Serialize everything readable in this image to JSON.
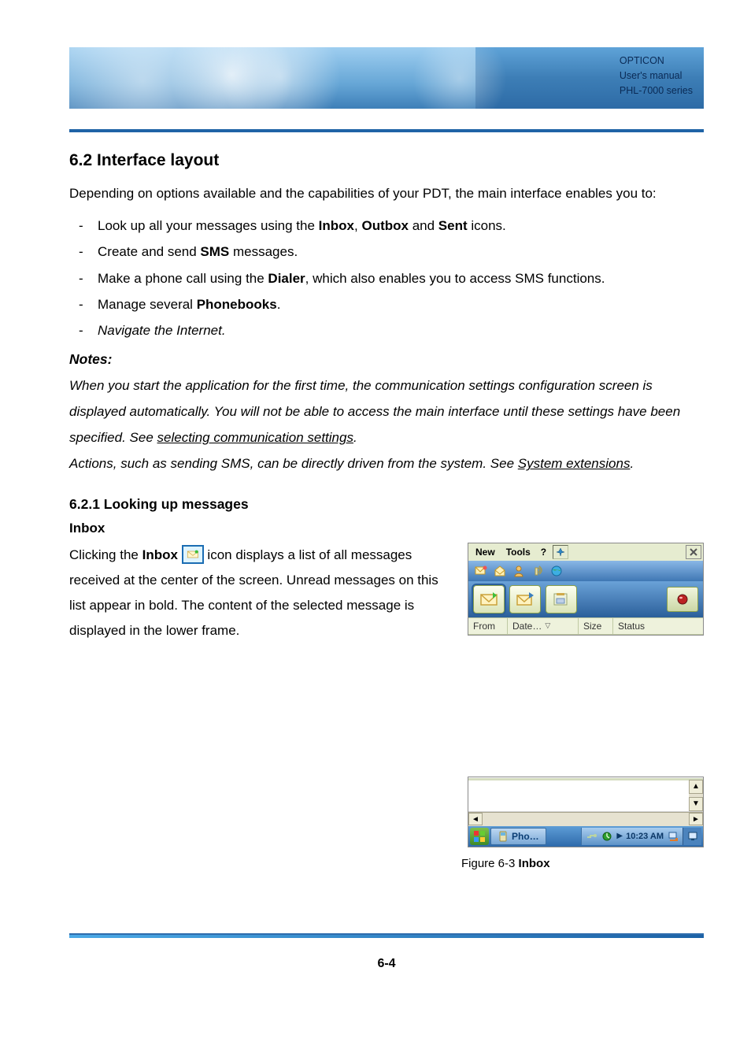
{
  "banner": {
    "line1": "OPTICON",
    "line2": "User's manual",
    "line3": "PHL-7000 series"
  },
  "section_title": "6.2 Interface layout",
  "intro": "Depending on options available and the capabilities of your PDT, the main interface enables you to:",
  "bullets": {
    "b1_pre": "Look up all your messages using the ",
    "b1_inbox": "Inbox",
    "b1_mid1": ", ",
    "b1_outbox": "Outbox",
    "b1_mid2": " and ",
    "b1_sent": "Sent",
    "b1_post": " icons.",
    "b2_pre": "Create and send ",
    "b2_sms": "SMS",
    "b2_post": " messages.",
    "b3_pre": "Make a phone call using the ",
    "b3_dialer": "Dialer",
    "b3_post": ", which also enables you to access SMS functions.",
    "b4_pre": "Manage several ",
    "b4_phone": "Phonebooks",
    "b4_post": ".",
    "b5": "Navigate the Internet."
  },
  "notes_heading": "Notes:",
  "notes": {
    "p1a": "When you start the application for the first time, the communication settings configuration screen is displayed automatically. You will not be able to access the main interface until these settings have been specified. See ",
    "p1link": "selecting communication settings",
    "p1b": ".",
    "p2a": "Actions, such as sending SMS, can be directly driven from the system. See ",
    "p2link": "System extensions",
    "p2b": "."
  },
  "sub_heading": "6.2.1 Looking up messages",
  "inbox_heading": "Inbox",
  "inbox_para": {
    "a": "Clicking the ",
    "b": "Inbox",
    "c": " icon displays a list of all messages received at the center of the screen. Unread messages on this list appear in bold. The content of the selected message is displayed in the lower frame."
  },
  "app": {
    "menu_new": "New",
    "menu_tools": "Tools",
    "menu_help": "?",
    "th_from": "From",
    "th_date": "Date…",
    "th_size": "Size",
    "th_status": "Status"
  },
  "task": {
    "label": "Pho…",
    "time": "10:23 AM"
  },
  "figure_caption_pre": "Figure 6-3 ",
  "figure_caption_bold": "Inbox",
  "page_number": "6-4"
}
